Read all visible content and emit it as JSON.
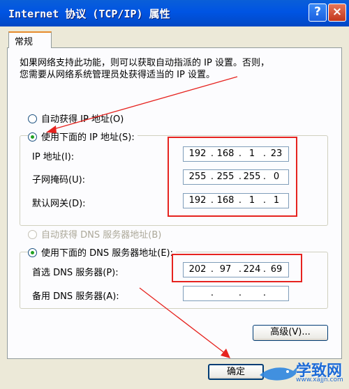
{
  "window": {
    "title": "Internet 协议 (TCP/IP) 属性",
    "help_glyph": "?",
    "close_glyph": "×"
  },
  "tab": {
    "label": "常规"
  },
  "description": {
    "line1": "如果网络支持此功能，则可以获取自动指派的 IP 设置。否则，",
    "line2": "您需要从网络系统管理员处获得适当的 IP 设置。"
  },
  "ip_section": {
    "auto_label": "自动获得 IP 地址(O)",
    "auto_selected": false,
    "manual_label": "使用下面的 IP 地址(S):",
    "manual_selected": true,
    "fields": [
      {
        "label": "IP 地址(I):",
        "octets": [
          "192",
          "168",
          "1",
          "23"
        ]
      },
      {
        "label": "子网掩码(U):",
        "octets": [
          "255",
          "255",
          "255",
          "0"
        ]
      },
      {
        "label": "默认网关(D):",
        "octets": [
          "192",
          "168",
          "1",
          "1"
        ]
      }
    ]
  },
  "dns_section": {
    "auto_label": "自动获得 DNS 服务器地址(B)",
    "auto_enabled": false,
    "manual_label": "使用下面的 DNS 服务器地址(E):",
    "manual_selected": true,
    "fields": [
      {
        "label": "首选 DNS 服务器(P):",
        "octets": [
          "202",
          "97",
          "224",
          "69"
        ]
      },
      {
        "label": "备用 DNS 服务器(A):",
        "octets": [
          "",
          "",
          "",
          ""
        ]
      }
    ]
  },
  "buttons": {
    "advanced": "高级(V)...",
    "ok": "确定"
  },
  "watermark": {
    "brand": "学致网",
    "url": "www.xajjn.com"
  },
  "colors": {
    "titlebar": "#0054e3",
    "annotation_red": "#e6231f",
    "radio_dot": "#21a121"
  }
}
